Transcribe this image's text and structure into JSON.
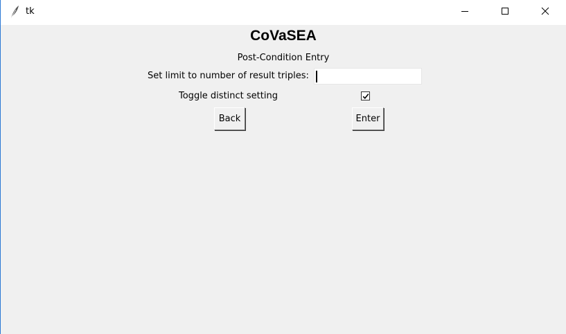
{
  "window": {
    "title": "tk",
    "icons": {
      "app": "feather-icon",
      "minimize": "minimize-icon",
      "maximize": "maximize-icon",
      "close": "close-icon"
    }
  },
  "main": {
    "heading": "CoVaSEA",
    "subheading": "Post-Condition Entry",
    "limit_label": "Set limit to number of result triples:",
    "limit_value": "",
    "toggle_label": "Toggle distinct setting",
    "toggle_checked": true,
    "back_label": "Back",
    "enter_label": "Enter"
  },
  "colors": {
    "window_bg": "#f0f0f0",
    "titlebar_bg": "#ffffff",
    "accent_border": "#2b78d4"
  }
}
